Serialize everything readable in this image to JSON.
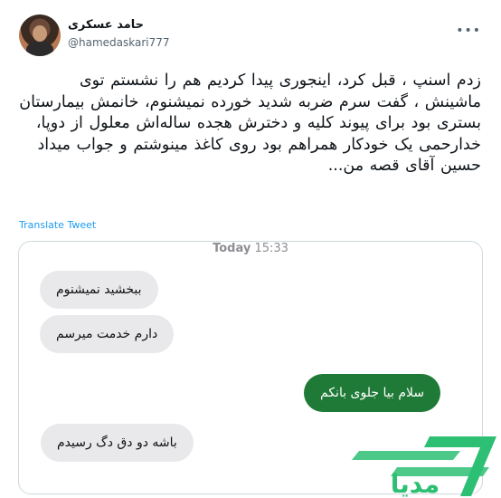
{
  "tweet": {
    "author_name": "حامد عسکری",
    "author_handle": "@hamedaskari777",
    "more_icon": "more-horizontal-icon",
    "body": "زدم اسنپ ، قبل کرد، اینجوری پیدا کردیم هم را نشستم توی ماشینش ، گفت سرم ضربه شدید خورده نمیشنوم، خانمش بیمارستان بستری بود برای پیوند کلیه و دخترش هجده ساله‌اش معلول از دوپا، خدارحمی یک خودکار همراهم بود روی کاغذ مینوشتم و جواب میداد حسین آقای قصه من...",
    "translate_label": "Translate Tweet"
  },
  "chat": {
    "day": "Today",
    "time": "15:33",
    "messages": [
      {
        "text": "ببخشید نمیشنوم",
        "side": "incoming"
      },
      {
        "text": "دارم خدمت میرسم",
        "side": "incoming"
      },
      {
        "text": "سلام بیا جلوی بانکم",
        "side": "outgoing"
      },
      {
        "text": "باشه دو دق دگ رسیدم",
        "side": "incoming"
      }
    ]
  },
  "watermark": {
    "text": "مدیا",
    "color": "#2dbf73"
  }
}
